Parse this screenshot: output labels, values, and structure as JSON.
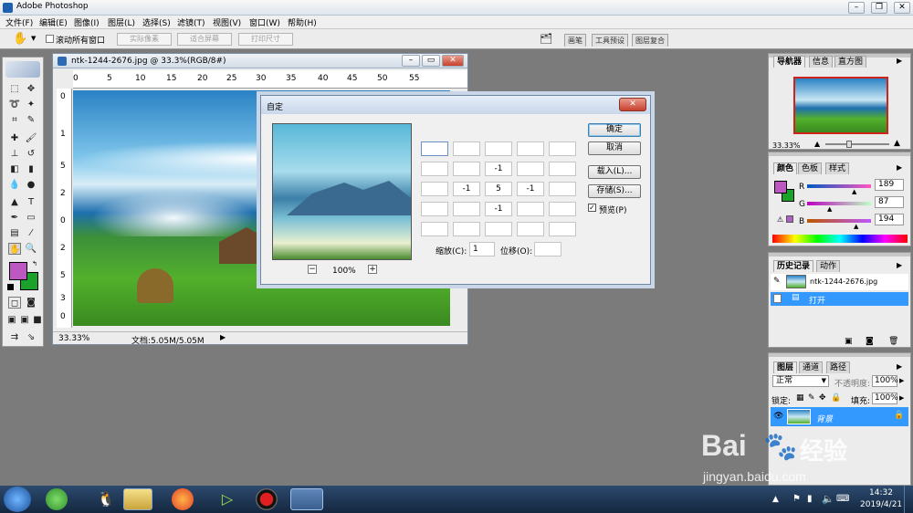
{
  "app": {
    "title": "Adobe Photoshop"
  },
  "menu": [
    "文件(F)",
    "编辑(E)",
    "图像(I)",
    "图层(L)",
    "选择(S)",
    "滤镜(T)",
    "视图(V)",
    "窗口(W)",
    "帮助(H)"
  ],
  "options": {
    "scroll_all": "滚动所有窗口",
    "actual_pixels": "实际像素",
    "fit_screen": "适合屏幕",
    "print_size": "打印尺寸"
  },
  "well_tabs": [
    "画笔",
    "工具预设",
    "图层复合"
  ],
  "document": {
    "title": "ntk-1244-2676.jpg @ 33.3%(RGB/8#)",
    "zoom": "33.33%",
    "doc_info": "文档:5.05M/5.05M",
    "ruler_top": [
      "0",
      "5",
      "10",
      "15",
      "20",
      "25",
      "30",
      "35",
      "40",
      "45",
      "50",
      "55"
    ],
    "ruler_left": [
      "0",
      "1",
      "5",
      "2",
      "0",
      "2",
      "5",
      "3",
      "0"
    ]
  },
  "dialog": {
    "title": "自定",
    "zoom": "100%",
    "matrix": [
      [
        "",
        "",
        "",
        "",
        ""
      ],
      [
        "",
        "",
        "-1",
        "",
        ""
      ],
      [
        "",
        "-1",
        "5",
        "-1",
        ""
      ],
      [
        "",
        "",
        "-1",
        "",
        ""
      ],
      [
        "",
        "",
        "",
        "",
        ""
      ]
    ],
    "scale_label": "缩放(C):",
    "scale_value": "1",
    "offset_label": "位移(O):",
    "offset_value": "",
    "ok": "确定",
    "cancel": "取消",
    "load": "载入(L)...",
    "save": "存储(S)...",
    "preview": "预览(P)"
  },
  "navigator": {
    "tabs": [
      "导航器",
      "信息",
      "直方图"
    ],
    "zoom": "33.33%"
  },
  "color": {
    "tabs": [
      "颜色",
      "色板",
      "样式"
    ],
    "r_label": "R",
    "g_label": "G",
    "b_label": "B",
    "r": "189",
    "g": "87",
    "b": "194",
    "fg": "#bd57c2",
    "bg": "#1aa22a"
  },
  "history": {
    "tabs": [
      "历史记录",
      "动作"
    ],
    "snapshot": "ntk-1244-2676.jpg",
    "step": "打开"
  },
  "layers": {
    "tabs": [
      "图层",
      "通道",
      "路径"
    ],
    "blend": "正常",
    "opacity_label": "不透明度:",
    "opacity": "100%",
    "lock_label": "锁定:",
    "fill_label": "填充:",
    "fill": "100%",
    "layer_name": "背景"
  },
  "taskbar": {
    "time": "14:32",
    "date": "2019/4/21"
  },
  "watermark": {
    "brand": "Bai",
    "brand2": "经验",
    "url": "jingyan.baidu.com"
  }
}
